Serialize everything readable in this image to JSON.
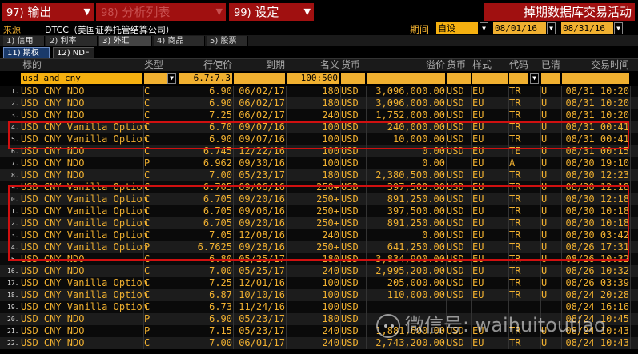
{
  "menu": {
    "export": {
      "num": "97)",
      "label": "输出"
    },
    "analysis": {
      "num": "98)",
      "label": "分析列表"
    },
    "settings": {
      "num": "99)",
      "label": "设定"
    },
    "title": "掉期数据库交易活动"
  },
  "source": {
    "label": "来源",
    "value": "DTCC（美国证券托管结算公司）",
    "period_label": "期间",
    "period_mode": "自设",
    "date_from": "08/01/16",
    "date_to": "08/31/16"
  },
  "tabs": [
    {
      "label": "1) 信用"
    },
    {
      "label": "2) 利率"
    },
    {
      "label": "3) 外汇"
    },
    {
      "label": "4) 商品"
    },
    {
      "label": "5) 股票"
    }
  ],
  "subtabs": [
    {
      "label": "11) 期权"
    },
    {
      "label": "12) NDF"
    }
  ],
  "columns": {
    "underlying": "标的",
    "type": "类型",
    "strike": "行使价",
    "expiry": "到期",
    "notional": "名义",
    "currency": "货币",
    "premium": "溢价",
    "premium_ccy": "货币",
    "style": "样式",
    "code": "代码",
    "cleared": "已清",
    "trade_time": "交易时间"
  },
  "filter": {
    "underlying": "usd and cny",
    "strike": "6.7:7.3",
    "notional": "100:500"
  },
  "rows": [
    {
      "n": "1.",
      "u": "USD CNY NDO",
      "t": "C",
      "k": "6.90",
      "e": "06/02/17",
      "no": "180",
      "c": "USD",
      "p": "3,096,000.00",
      "pc": "USD",
      "s": "EU",
      "cd": "TR",
      "cl": "U",
      "tt": "08/31 10:20"
    },
    {
      "n": "2.",
      "u": "USD CNY NDO",
      "t": "C",
      "k": "6.90",
      "e": "06/02/17",
      "no": "180",
      "c": "USD",
      "p": "3,096,000.00",
      "pc": "USD",
      "s": "EU",
      "cd": "TR",
      "cl": "U",
      "tt": "08/31 10:20"
    },
    {
      "n": "3.",
      "u": "USD CNY NDO",
      "t": "C",
      "k": "7.25",
      "e": "06/02/17",
      "no": "240",
      "c": "USD",
      "p": "1,752,000.00",
      "pc": "USD",
      "s": "EU",
      "cd": "TR",
      "cl": "U",
      "tt": "08/31 10:20"
    },
    {
      "n": "4.",
      "u": "USD CNY Vanilla Option",
      "t": "C",
      "k": "6.70",
      "e": "09/07/16",
      "no": "100",
      "c": "USD",
      "p": "240,000.00",
      "pc": "USD",
      "s": "EU",
      "cd": "TR",
      "cl": "U",
      "tt": "08/31 00:41"
    },
    {
      "n": "5.",
      "u": "USD CNY Vanilla Option",
      "t": "C",
      "k": "6.90",
      "e": "09/07/16",
      "no": "100",
      "c": "USD",
      "p": "10,000.00",
      "pc": "USD",
      "s": "EU",
      "cd": "TR",
      "cl": "U",
      "tt": "08/31 00:41"
    },
    {
      "n": "6.",
      "u": "USD CNY NDO",
      "t": "C",
      "k": "6.745",
      "e": "12/22/16",
      "no": "100",
      "c": "USD",
      "p": "0.00",
      "pc": "USD",
      "s": "EU",
      "cd": "TE",
      "cl": "U",
      "tt": "08/31 00:15"
    },
    {
      "n": "7.",
      "u": "USD CNY NDO",
      "t": "P",
      "k": "6.962",
      "e": "09/30/16",
      "no": "100",
      "c": "USD",
      "p": "0.00",
      "pc": "",
      "s": "EU",
      "cd": "A",
      "cl": "U",
      "tt": "08/30 19:10"
    },
    {
      "n": "8.",
      "u": "USD CNY NDO",
      "t": "C",
      "k": "7.00",
      "e": "05/23/17",
      "no": "180",
      "c": "USD",
      "p": "2,380,500.00",
      "pc": "USD",
      "s": "EU",
      "cd": "TR",
      "cl": "U",
      "tt": "08/30 12:23"
    },
    {
      "n": "9.",
      "u": "USD CNY Vanilla Option",
      "t": "C",
      "k": "6.705",
      "e": "09/06/16",
      "no": "250+",
      "c": "USD",
      "p": "397,500.00",
      "pc": "USD",
      "s": "EU",
      "cd": "TR",
      "cl": "U",
      "tt": "08/30 12:18"
    },
    {
      "n": "10.",
      "u": "USD CNY Vanilla Option",
      "t": "C",
      "k": "6.705",
      "e": "09/20/16",
      "no": "250+",
      "c": "USD",
      "p": "891,250.00",
      "pc": "USD",
      "s": "EU",
      "cd": "TR",
      "cl": "U",
      "tt": "08/30 12:18"
    },
    {
      "n": "11.",
      "u": "USD CNY Vanilla Option",
      "t": "C",
      "k": "6.705",
      "e": "09/06/16",
      "no": "250+",
      "c": "USD",
      "p": "397,500.00",
      "pc": "USD",
      "s": "EU",
      "cd": "TR",
      "cl": "U",
      "tt": "08/30 10:18"
    },
    {
      "n": "12.",
      "u": "USD CNY Vanilla Option",
      "t": "C",
      "k": "6.705",
      "e": "09/20/16",
      "no": "250+",
      "c": "USD",
      "p": "891,250.00",
      "pc": "USD",
      "s": "EU",
      "cd": "TR",
      "cl": "U",
      "tt": "08/30 10:18"
    },
    {
      "n": "13.",
      "u": "USD CNY Vanilla Option",
      "t": "C",
      "k": "7.05",
      "e": "12/08/16",
      "no": "240",
      "c": "USD",
      "p": "0.00",
      "pc": "USD",
      "s": "EU",
      "cd": "TR",
      "cl": "U",
      "tt": "08/30 03:42"
    },
    {
      "n": "14.",
      "u": "USD CNY Vanilla Option",
      "t": "P",
      "k": "6.7625",
      "e": "09/28/16",
      "no": "250+",
      "c": "USD",
      "p": "641,250.00",
      "pc": "USD",
      "s": "EU",
      "cd": "TR",
      "cl": "U",
      "tt": "08/26 17:31"
    },
    {
      "n": "15.",
      "u": "USD CNY NDO",
      "t": "C",
      "k": "6.80",
      "e": "05/25/17",
      "no": "180",
      "c": "USD",
      "p": "3,834,900.00",
      "pc": "USD",
      "s": "EU",
      "cd": "TR",
      "cl": "U",
      "tt": "08/26 10:32"
    },
    {
      "n": "16.",
      "u": "USD CNY NDO",
      "t": "C",
      "k": "7.00",
      "e": "05/25/17",
      "no": "240",
      "c": "USD",
      "p": "2,995,200.00",
      "pc": "USD",
      "s": "EU",
      "cd": "TR",
      "cl": "U",
      "tt": "08/26 10:32"
    },
    {
      "n": "17.",
      "u": "USD CNY Vanilla Option",
      "t": "C",
      "k": "7.25",
      "e": "12/01/16",
      "no": "100",
      "c": "USD",
      "p": "205,000.00",
      "pc": "USD",
      "s": "EU",
      "cd": "TR",
      "cl": "U",
      "tt": "08/26 03:39"
    },
    {
      "n": "18.",
      "u": "USD CNY Vanilla Option",
      "t": "C",
      "k": "6.87",
      "e": "10/10/16",
      "no": "100",
      "c": "USD",
      "p": "110,000.00",
      "pc": "USD",
      "s": "EU",
      "cd": "TR",
      "cl": "U",
      "tt": "08/24 20:28"
    },
    {
      "n": "19.",
      "u": "USD CNY Vanilla Option",
      "t": "C",
      "k": "6.73",
      "e": "11/24/16",
      "no": "100",
      "c": "USD",
      "p": "",
      "pc": "",
      "s": "",
      "cd": "",
      "cl": "",
      "tt": "08/24 16:16"
    },
    {
      "n": "20.",
      "u": "USD CNY NDO",
      "t": "P",
      "k": "6.90",
      "e": "05/23/17",
      "no": "180",
      "c": "USD",
      "p": "",
      "pc": "",
      "s": "",
      "cd": "",
      "cl": "",
      "tt": "08/24 10:45"
    },
    {
      "n": "21.",
      "u": "USD CNY NDO",
      "t": "P",
      "k": "7.15",
      "e": "05/23/17",
      "no": "240",
      "c": "USD",
      "p": "1,881,600.00",
      "pc": "USD",
      "s": "EU",
      "cd": "TR",
      "cl": "U",
      "tt": "08/24 10:43"
    },
    {
      "n": "22.",
      "u": "USD CNY NDO",
      "t": "C",
      "k": "7.00",
      "e": "06/01/17",
      "no": "240",
      "c": "USD",
      "p": "2,743,200.00",
      "pc": "USD",
      "s": "EU",
      "cd": "TR",
      "cl": "U",
      "tt": "08/24 10:43"
    }
  ],
  "watermark": {
    "text": "微信号: waihuitoutiao"
  }
}
